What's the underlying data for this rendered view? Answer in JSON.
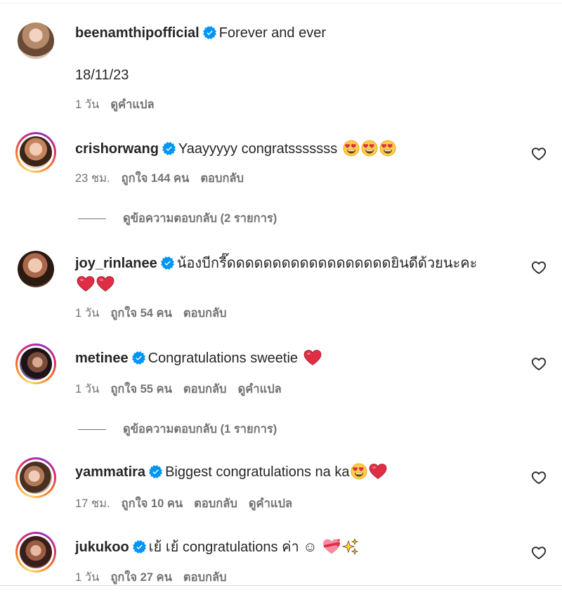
{
  "caption": {
    "username": "beenamthipofficial",
    "text": "Forever and ever",
    "date_line": "18/11/23",
    "time": "1 วัน",
    "translate": "ดูคำแปล"
  },
  "comments": [
    {
      "username": "crishorwang",
      "text": "Yaayyyyy congratsssssss",
      "emojis": [
        "heart-eyes",
        "heart-eyes",
        "heart-eyes"
      ],
      "time": "23 ชม.",
      "likes": "ถูกใจ 144 คน",
      "reply": "ตอบกลับ",
      "view_replies": "ดูข้อความตอบกลับ (2 รายการ)"
    },
    {
      "username": "joy_rinlanee",
      "text": "น้องบีกรี๊ดดดดดดดดดดดดดดดดดดยินดีด้วยนะคะ",
      "emojis": [
        "red-heart",
        "red-heart"
      ],
      "time": "1 วัน",
      "likes": "ถูกใจ 54 คน",
      "reply": "ตอบกลับ"
    },
    {
      "username": "metinee",
      "text": "Congratulations sweetie",
      "emojis": [
        "red-heart"
      ],
      "time": "1 วัน",
      "likes": "ถูกใจ 55 คน",
      "reply": "ตอบกลับ",
      "translate": "ดูคำแปล",
      "view_replies": "ดูข้อความตอบกลับ (1 รายการ)"
    },
    {
      "username": "yammatira",
      "text": "Biggest congratulations na ka",
      "emojis": [
        "heart-eyes",
        "red-heart"
      ],
      "time": "17 ชม.",
      "likes": "ถูกใจ 10 คน",
      "reply": "ตอบกลับ",
      "translate": "ดูคำแปล"
    },
    {
      "username": "jukukoo",
      "text": "เย้ เย้ congratulations ค่า ☺",
      "emojis": [
        "heart-with-ribbon",
        "sparkles"
      ],
      "time": "1 วัน",
      "likes": "ถูกใจ 27 คน",
      "reply": "ตอบกลับ"
    }
  ],
  "colors": {
    "verified": "#0095f6",
    "meta_text": "#737373",
    "emoji_red": "#e0245e"
  },
  "icons": [
    "verified-badge-icon",
    "like-heart-icon",
    "heart-eyes-emoji",
    "red-heart-emoji",
    "sparkles-emoji"
  ]
}
